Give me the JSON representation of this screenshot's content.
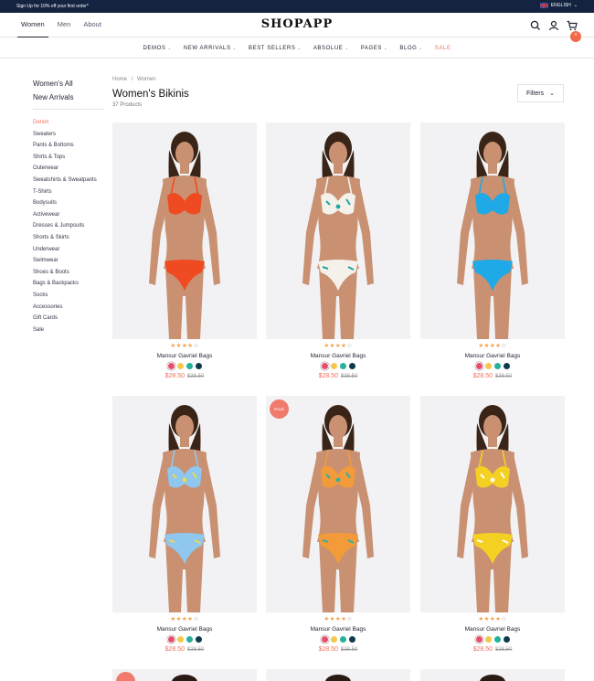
{
  "topbar": {
    "promo": "Sign Up for 10% off your first order*",
    "language": "ENGLISH"
  },
  "header": {
    "logo": "SHOPAPP",
    "gender_tabs": [
      {
        "label": "Women",
        "active": true
      },
      {
        "label": "Men"
      },
      {
        "label": "About"
      }
    ],
    "cart_count": "0",
    "icons": [
      "search-icon",
      "user-icon",
      "cart-icon"
    ]
  },
  "nav": [
    {
      "label": "DEMOS",
      "dropdown": true
    },
    {
      "label": "NEW ARRIVALS",
      "dropdown": true
    },
    {
      "label": "BEST SELLERS",
      "dropdown": true
    },
    {
      "label": "ABSOLUE",
      "dropdown": true
    },
    {
      "label": "PAGES",
      "dropdown": true
    },
    {
      "label": "BLOG",
      "dropdown": true
    },
    {
      "label": "SALE",
      "dropdown": false,
      "color": "#f07058"
    }
  ],
  "sidebar": {
    "top_links": [
      "Women's All",
      "New Arrivals"
    ],
    "categories": [
      "Denim",
      "Sweaters",
      "Pants & Bottoms",
      "Shirts & Tops",
      "Outerwear",
      "Sweatshirts & Sweatpants",
      "T-Shirts",
      "Bodysuits",
      "Activewear",
      "Dresses & Jumpsuits",
      "Shorts & Skirts",
      "Underwear",
      "Swimwear",
      "Shoes & Boots",
      "Bags & Backpacks",
      "Socks",
      "Accessories",
      "Gift Cards",
      "Sale"
    ],
    "active_category": "Denim"
  },
  "breadcrumb": {
    "home": "Home",
    "sep": "/",
    "current": "Women"
  },
  "page": {
    "title": "Women's Bikinis",
    "count": "37 Products",
    "filters_label": "Filters"
  },
  "swatch_colors": [
    "#e84d6c",
    "#f2c94c",
    "#27b19b",
    "#0f3b4c"
  ],
  "products": [
    {
      "name": "Mansur Gavriel Bags",
      "price": "$28.50",
      "old_price": "$38.50",
      "rating": 4,
      "sale": false,
      "sale_label": "",
      "top_color": "#ef4a22",
      "bottom_color": "#ef4a22",
      "accent": "#ef4a22"
    },
    {
      "name": "Mansur Gavriel Bags",
      "price": "$28.50",
      "old_price": "$38.50",
      "rating": 4,
      "sale": false,
      "sale_label": "",
      "top_color": "#f4f1ea",
      "bottom_color": "#f4f1ea",
      "accent": "#1fa7a0"
    },
    {
      "name": "Mansur Gavriel Bags",
      "price": "$28.50",
      "old_price": "$38.50",
      "rating": 4,
      "sale": false,
      "sale_label": "",
      "top_color": "#1fa9e6",
      "bottom_color": "#1fa9e6",
      "accent": "#1fa9e6"
    },
    {
      "name": "Mansur Gavriel Bags",
      "price": "$28.50",
      "old_price": "$38.50",
      "rating": 4,
      "sale": false,
      "sale_label": "",
      "top_color": "#8fc7ee",
      "bottom_color": "#8fc7ee",
      "accent": "#f2d84a"
    },
    {
      "name": "Mansur Gavriel Bags",
      "price": "$28.50",
      "old_price": "$38.50",
      "rating": 4,
      "sale": true,
      "sale_label": "SALE",
      "top_color": "#f39a3a",
      "bottom_color": "#f39a3a",
      "accent": "#2bb3a4"
    },
    {
      "name": "Mansur Gavriel Bags",
      "price": "$28.50",
      "old_price": "$38.50",
      "rating": 4,
      "sale": false,
      "sale_label": "",
      "top_color": "#f4d023",
      "bottom_color": "#f4d023",
      "accent": "#ffffff"
    }
  ]
}
